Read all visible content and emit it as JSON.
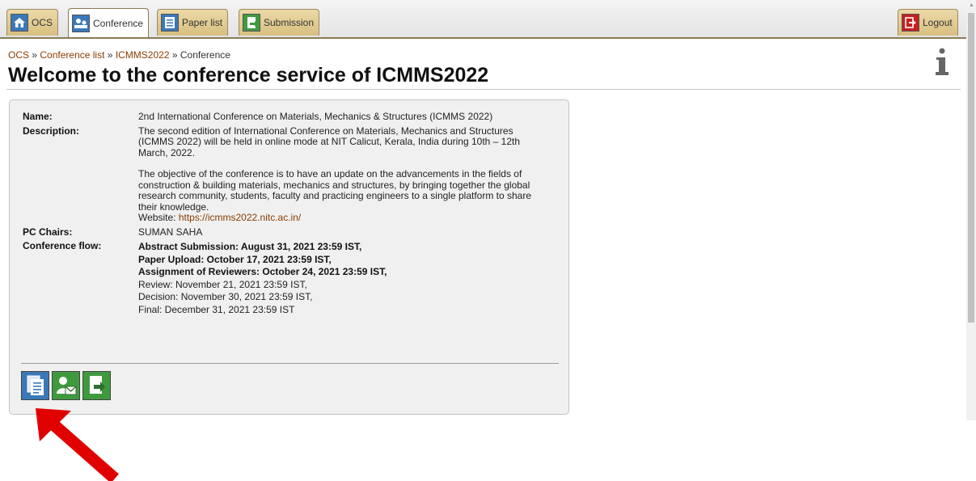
{
  "tabs": [
    {
      "label": "OCS",
      "icon": "home-icon"
    },
    {
      "label": "Conference",
      "icon": "conference-icon",
      "active": true
    },
    {
      "label": "Paper list",
      "icon": "list-icon"
    },
    {
      "label": "Submission",
      "icon": "submission-icon"
    }
  ],
  "logout": {
    "label": "Logout",
    "icon": "logout-icon"
  },
  "breadcrumb": {
    "items": [
      "OCS",
      "Conference list",
      "ICMMS2022",
      "Conference"
    ],
    "separator": "»"
  },
  "title": "Welcome to the conference service of ICMMS2022",
  "conference": {
    "name_label": "Name:",
    "name": "2nd International Conference on Materials, Mechanics & Structures (ICMMS 2022)",
    "description_label": "Description:",
    "description_p1": "The second edition of International Conference on Materials, Mechanics and Structures (ICMMS 2022) will be held in online mode at NIT Calicut, Kerala, India during 10th – 12th March, 2022.",
    "description_p2": "The objective of the conference is to have an update on the advancements in the fields of construction & building materials, mechanics and structures, by bringing together the global research community, students, faculty and practicing engineers to a single platform to share their knowledge.",
    "website_label": "Website: ",
    "website": "https://icmms2022.nitc.ac.in/",
    "pc_chairs_label": "PC Chairs:",
    "pc_chairs": "SUMAN SAHA",
    "flow_label": "Conference flow:",
    "flow": [
      "Abstract Submission: August 31, 2021 23:59 IST,",
      "Paper Upload: October 17, 2021 23:59 IST,",
      "Assignment of Reviewers: October 24, 2021 23:59 IST,",
      "Review: November 21, 2021 23:59 IST,",
      "Decision: November 30, 2021 23:59 IST,",
      "Final: December 31, 2021 23:59 IST"
    ]
  },
  "actions": [
    {
      "icon": "paper-list-icon"
    },
    {
      "icon": "contact-mail-icon"
    },
    {
      "icon": "submission-icon"
    }
  ],
  "colors": {
    "accent": "#8a3d00",
    "tab": "#d8bf80",
    "annotation_arrow": "#e00000"
  }
}
